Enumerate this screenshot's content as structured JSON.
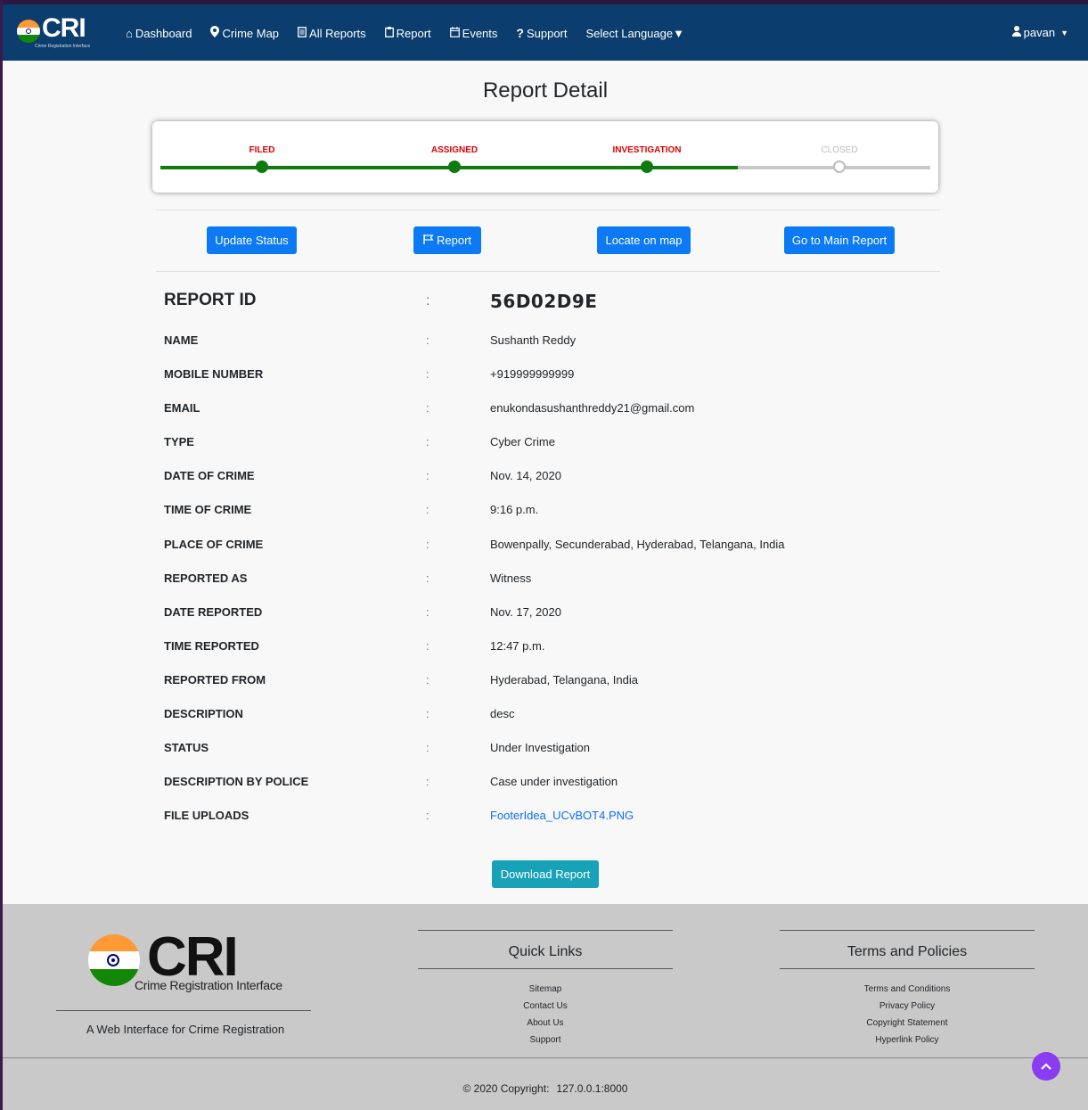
{
  "navbar": {
    "brand": "CRI",
    "brand_tagline": "Crime Registration Interface",
    "items": [
      {
        "label": "Dashboard",
        "icon": "home-icon"
      },
      {
        "label": "Crime Map",
        "icon": "map-marker-icon"
      },
      {
        "label": "All Reports",
        "icon": "document-icon"
      },
      {
        "label": "Report",
        "icon": "clipboard-icon"
      },
      {
        "label": "Events",
        "icon": "calendar-icon"
      },
      {
        "label": "Support",
        "icon": "question-icon"
      },
      {
        "label": "Select Language▼",
        "icon": ""
      }
    ],
    "user": "pavan"
  },
  "page": {
    "title": "Report Detail"
  },
  "progress": {
    "steps": [
      {
        "label": "FILED",
        "state": "done"
      },
      {
        "label": "ASSIGNED",
        "state": "done"
      },
      {
        "label": "INVESTIGATION",
        "state": "done"
      },
      {
        "label": "CLOSED",
        "state": "todo"
      }
    ],
    "fill_percent": 75,
    "colors": {
      "done": "#0f7a0f",
      "label_done": "#e00000",
      "todo": "#bdbdbd"
    }
  },
  "actions": {
    "update_status": "Update Status",
    "report": "Report",
    "locate": "Locate on map",
    "main_report": "Go to Main Report"
  },
  "report": {
    "id_label": "REPORT ID",
    "id_value": "56D02D9E",
    "separator": ":",
    "fields": [
      {
        "label": "NAME",
        "value": "Sushanth Reddy"
      },
      {
        "label": "MOBILE NUMBER",
        "value": "+919999999999"
      },
      {
        "label": "EMAIL",
        "value": "enukondasushanthreddy21@gmail.com"
      },
      {
        "label": "TYPE",
        "value": "Cyber Crime"
      },
      {
        "label": "DATE OF CRIME",
        "value": "Nov. 14, 2020"
      },
      {
        "label": "TIME OF CRIME",
        "value": "9:16 p.m."
      },
      {
        "label": "PLACE OF CRIME",
        "value": "Bowenpally, Secunderabad, Hyderabad, Telangana, India"
      },
      {
        "label": "REPORTED AS",
        "value": "Witness"
      },
      {
        "label": "DATE REPORTED",
        "value": "Nov. 17, 2020"
      },
      {
        "label": "TIME REPORTED",
        "value": "12:47 p.m."
      },
      {
        "label": "REPORTED FROM",
        "value": "Hyderabad, Telangana, India"
      },
      {
        "label": "DESCRIPTION",
        "value": "desc"
      },
      {
        "label": "STATUS",
        "value": "Under Investigation"
      },
      {
        "label": "DESCRIPTION BY POLICE",
        "value": "Case under investigation"
      },
      {
        "label": "FILE UPLOADS",
        "value": "FooterIdea_UCvBOT4.PNG"
      }
    ],
    "download": "Download Report"
  },
  "footer": {
    "logo_word": "CRI",
    "logo_tagline": "Crime Registration Interface",
    "tagline": "A Web Interface for Crime Registration",
    "quick_links_title": "Quick Links",
    "quick_links": [
      "Sitemap",
      "Contact Us",
      "About Us",
      "Support"
    ],
    "terms_title": "Terms and Policies",
    "terms_links": [
      "Terms and Conditions",
      "Privacy Policy",
      "Copyright Statement",
      "Hyperlink Policy"
    ],
    "copyright": "© 2020 Copyright:",
    "address": "127.0.0.1:8000"
  }
}
